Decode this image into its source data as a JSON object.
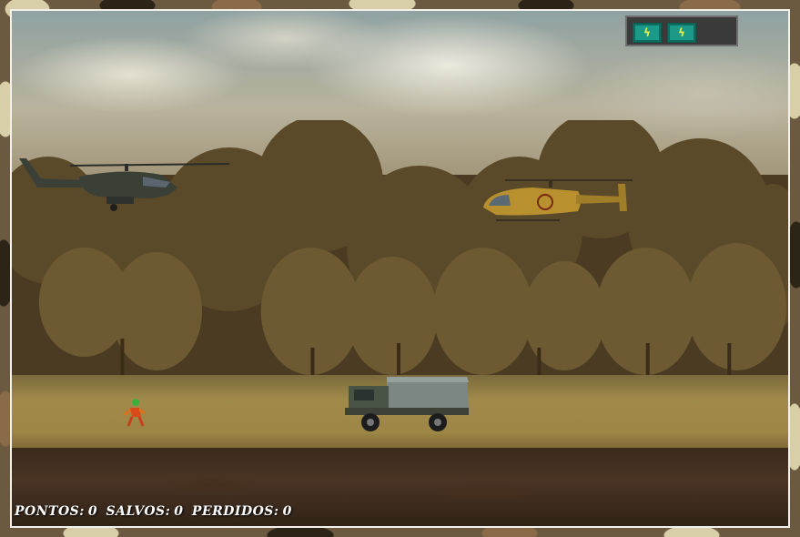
{
  "game": {
    "hud": {
      "score_label": "PONTOS:",
      "score_value": "0",
      "saved_label": "SALVOS:",
      "saved_value": "0",
      "lost_label": "PERDIDOS:",
      "lost_value": "0"
    },
    "lives": {
      "count": 2,
      "icon": "energy-bolt-icon",
      "color": "#1b9a8a"
    },
    "entities": [
      {
        "name": "enemy-attack-helicopter",
        "color": "#3b4037"
      },
      {
        "name": "player-helicopter",
        "color": "#b8912e"
      },
      {
        "name": "army-truck",
        "color": "#556055"
      },
      {
        "name": "soldier-hostage",
        "color": "#d84a1a"
      }
    ]
  }
}
